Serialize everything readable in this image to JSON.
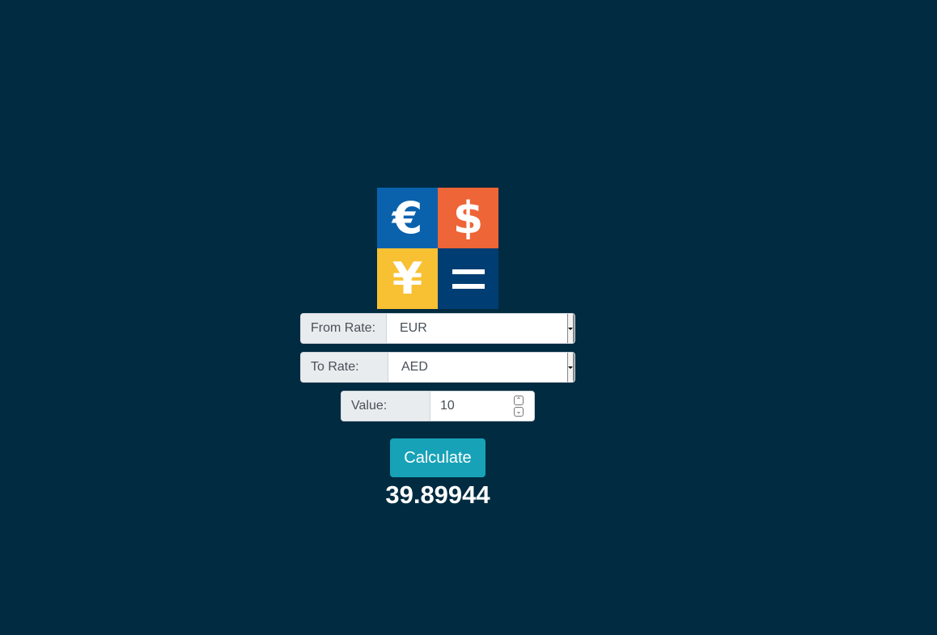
{
  "logo": {
    "euro_symbol": "€",
    "dollar_symbol": "$",
    "yen_symbol": "¥",
    "colors": {
      "euro": "#0a62ad",
      "dollar": "#ee6537",
      "yen": "#f8c033",
      "equals": "#003d73"
    },
    "icon": "currency-exchange-logo"
  },
  "form": {
    "from_rate": {
      "label": "From Rate:",
      "selected": "EUR"
    },
    "to_rate": {
      "label": "To Rate:",
      "selected": "AED"
    },
    "value": {
      "label": "Value:",
      "current": "10"
    },
    "calculate_label": "Calculate"
  },
  "result": "39.89944",
  "theme": {
    "background": "#002b40",
    "button": "#17a2b8"
  }
}
